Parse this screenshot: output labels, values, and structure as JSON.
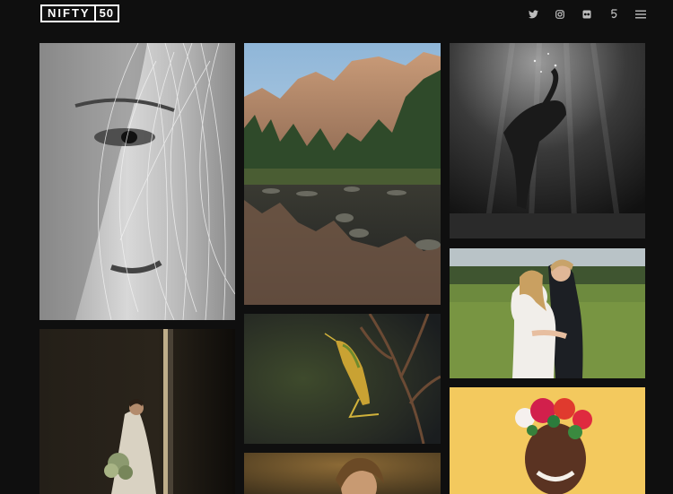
{
  "header": {
    "logo_word": "NIFTY",
    "logo_number": "50",
    "icons": [
      "twitter-icon",
      "instagram-icon",
      "flickr-icon",
      "500px-icon",
      "hamburger-menu-icon"
    ]
  },
  "gallery": {
    "items": [
      "bw-freckled-face-portrait",
      "yosemite-mountain-reflection",
      "underwater-swimmer",
      "couple-embrace-field",
      "bride-window-light",
      "grasshopper-on-branch",
      "bride-flower-crown-smiling",
      "child-portrait"
    ]
  },
  "colors": {
    "background": "#0f0f0f",
    "accent": "#ffffff",
    "icon": "#bdbdbd"
  }
}
